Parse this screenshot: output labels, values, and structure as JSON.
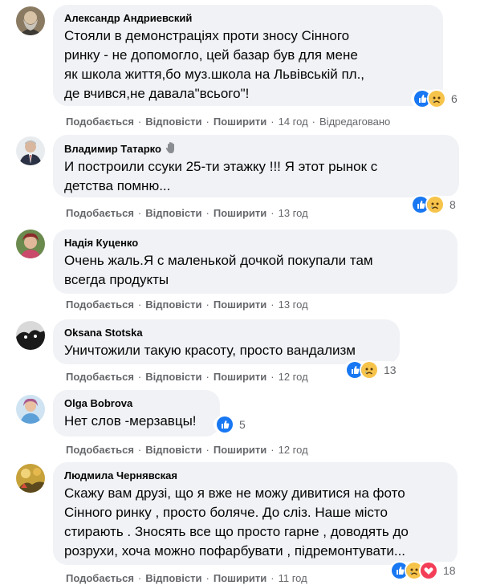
{
  "actions": {
    "like": "Подобається",
    "reply": "Відповісти",
    "share": "Поширити",
    "separator": "·"
  },
  "colors": {
    "like_blue": "#1877f2",
    "sad_yellow": "#f7c44b",
    "love_red": "#f33e58",
    "bubble_bg": "#f0f2f5",
    "meta_gray": "#65676b"
  },
  "comments": [
    {
      "author": "Александр Андриевский",
      "text": "Стояли в демонстраціях проти зносу Сінного\nринку - не допомогло, цей базар був для мене\nяк школа життя,бо муз.школа на Львівській пл.,\nде вчився,не давала\"всього\"!",
      "reactions": [
        "like-icon",
        "sad-icon"
      ],
      "count": "6",
      "time": "14 год",
      "edited": "Відредаговано"
    },
    {
      "author": "Владимир Татарко",
      "badge": "wave-hand-icon",
      "text": "И построили ссуки 25-ти этажку !!! Я этот рынок с\nдетства помню...",
      "reactions": [
        "like-icon",
        "sad-icon"
      ],
      "count": "8",
      "time": "13 год"
    },
    {
      "author": "Надія Куценко",
      "text": "Очень жаль.Я с маленькой дочкой покупали там\nвсегда продукты",
      "time": "13 год"
    },
    {
      "author": "Oksana Stotska",
      "text": "Уничтожили такую красоту, просто вандализм",
      "reactions": [
        "like-icon",
        "sad-icon"
      ],
      "count": "13",
      "time": "12 год"
    },
    {
      "author": "Olga Bobrova",
      "text": "Нет слов -мерзавцы!",
      "reactions": [
        "like-icon"
      ],
      "count": "5",
      "time": "12 год"
    },
    {
      "author": "Людмила Чернявская",
      "text": "Скажу вам друзі, що я вже не можу дивитися на фото\nСінного ринку , просто боляче. До сліз. Наше місто\nстирають . Зносять все що просто гарне , доводять до\nрозрухи, хоча можно пофарбувати , підремонтувати...",
      "reactions": [
        "like-icon",
        "sad-icon",
        "love-icon"
      ],
      "count": "18",
      "time": "11 год"
    }
  ]
}
